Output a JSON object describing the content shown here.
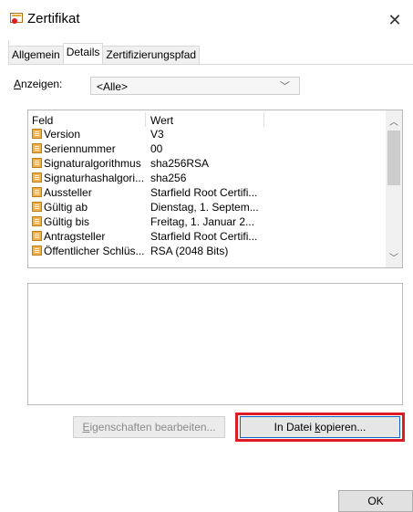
{
  "window": {
    "title": "Zertifikat",
    "close_glyph": "✕"
  },
  "tabs": [
    {
      "label": "Allgemein",
      "active": false
    },
    {
      "label": "Details",
      "active": true
    },
    {
      "label": "Zertifizierungspfad",
      "active": false
    }
  ],
  "show": {
    "label_accesskey": "A",
    "label_rest": "nzeigen:",
    "selected": "<Alle>"
  },
  "list": {
    "columns": [
      "Feld",
      "Wert"
    ],
    "rows": [
      {
        "field": "Version",
        "value": "V3"
      },
      {
        "field": "Seriennummer",
        "value": "00"
      },
      {
        "field": "Signaturalgorithmus",
        "value": "sha256RSA"
      },
      {
        "field": "Signaturhashalgori...",
        "value": "sha256"
      },
      {
        "field": "Aussteller",
        "value": "Starfield Root Certifi..."
      },
      {
        "field": "Gültig ab",
        "value": "Dienstag, 1. Septem..."
      },
      {
        "field": "Gültig bis",
        "value": "Freitag, 1. Januar 2..."
      },
      {
        "field": "Antragsteller",
        "value": "Starfield Root Certifi..."
      },
      {
        "field": "Öffentlicher Schlüs...",
        "value": "RSA (2048 Bits)"
      }
    ]
  },
  "buttons": {
    "edit_props_accesskey": "E",
    "edit_props_rest": "igenschaften bearbeiten...",
    "copy_pre": "In Datei ",
    "copy_accesskey": "k",
    "copy_post": "opieren...",
    "ok": "OK"
  },
  "colors": {
    "highlight_outline": "#e01b24",
    "focus_border": "#0a63c9",
    "field_icon": "#f1b04a"
  }
}
